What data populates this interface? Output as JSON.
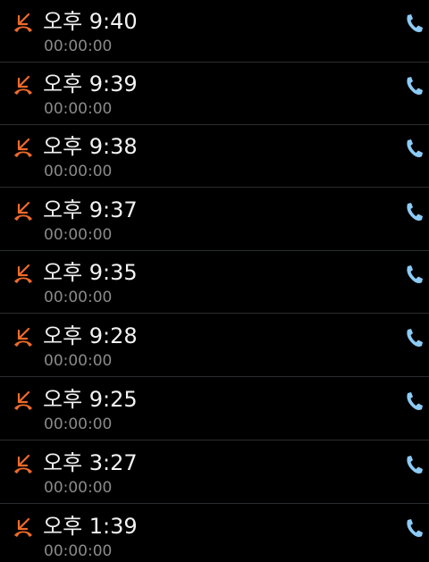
{
  "colors": {
    "background": "#000000",
    "missed_icon": "#f06a2a",
    "call_icon": "#8ccbf5",
    "primary_text": "#f2f2f2",
    "secondary_text": "#8a8a8a",
    "divider": "#2a2d30"
  },
  "call_log": {
    "entries": [
      {
        "time": "오후 9:40",
        "duration": "00:00:00",
        "status_icon": "missed-call-icon",
        "action_icon": "phone-icon"
      },
      {
        "time": "오후 9:39",
        "duration": "00:00:00",
        "status_icon": "missed-call-icon",
        "action_icon": "phone-icon"
      },
      {
        "time": "오후 9:38",
        "duration": "00:00:00",
        "status_icon": "missed-call-icon",
        "action_icon": "phone-icon"
      },
      {
        "time": "오후 9:37",
        "duration": "00:00:00",
        "status_icon": "missed-call-icon",
        "action_icon": "phone-icon"
      },
      {
        "time": "오후 9:35",
        "duration": "00:00:00",
        "status_icon": "missed-call-icon",
        "action_icon": "phone-icon"
      },
      {
        "time": "오후 9:28",
        "duration": "00:00:00",
        "status_icon": "missed-call-icon",
        "action_icon": "phone-icon"
      },
      {
        "time": "오후 9:25",
        "duration": "00:00:00",
        "status_icon": "missed-call-icon",
        "action_icon": "phone-icon"
      },
      {
        "time": "오후 3:27",
        "duration": "00:00:00",
        "status_icon": "missed-call-icon",
        "action_icon": "phone-icon"
      },
      {
        "time": "오후 1:39",
        "duration": "00:00:00",
        "status_icon": "missed-call-icon",
        "action_icon": "phone-icon"
      }
    ]
  }
}
